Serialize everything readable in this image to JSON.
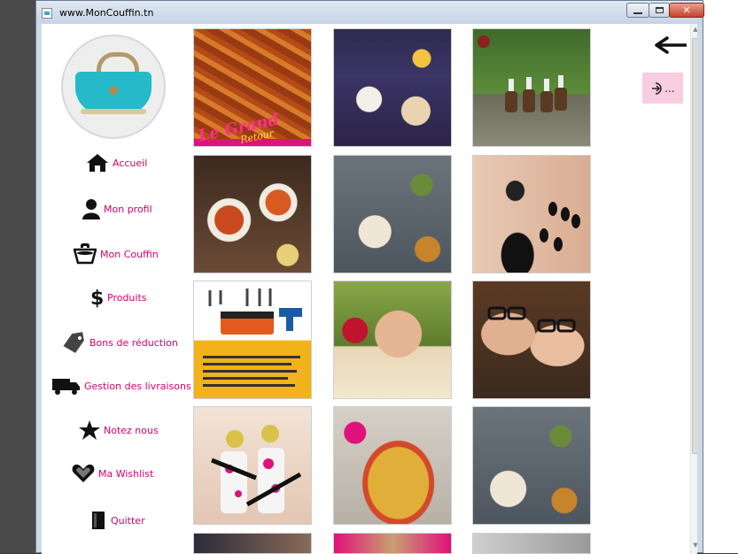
{
  "window": {
    "title": "www.MonCouffin.tn",
    "icons": {
      "app": "app-window-icon",
      "minimize": "minimize-icon",
      "maximize": "maximize-icon",
      "close": "close-icon"
    },
    "close_glyph": "✕"
  },
  "sidebar": {
    "avatar_icon": "bag-logo",
    "items": [
      {
        "label": "Accueil",
        "icon": "home-icon"
      },
      {
        "label": "Mon profil",
        "icon": "user-icon"
      },
      {
        "label": "Mon Couffin",
        "icon": "basket-icon"
      },
      {
        "label": "Produits",
        "icon": "dollar-icon"
      },
      {
        "label": "Bons de réduction",
        "icon": "tag-icon"
      },
      {
        "label": "Gestion des livraisons",
        "icon": "truck-icon"
      },
      {
        "label": "Notez nous",
        "icon": "star-icon"
      },
      {
        "label": "Ma Wishlist",
        "icon": "heart-icon"
      },
      {
        "label": "Quitter",
        "icon": "exit-icon"
      }
    ],
    "accent_color": "#d5006d"
  },
  "tiles": [
    {
      "subject": "pizza",
      "caption": "Le Grand",
      "caption_sub": "Retour"
    },
    {
      "subject": "breakfast-table"
    },
    {
      "subject": "horse-riding"
    },
    {
      "subject": "pasta-dishes"
    },
    {
      "subject": "restaurant-table"
    },
    {
      "subject": "makeup-face"
    },
    {
      "subject": "tools-kit"
    },
    {
      "subject": "spa-massage"
    },
    {
      "subject": "eyewear-couple"
    },
    {
      "subject": "paintball"
    },
    {
      "subject": "buffet-platter"
    },
    {
      "subject": "restaurant-table-2"
    },
    {
      "subject": "partial-1"
    },
    {
      "subject": "partial-2"
    },
    {
      "subject": "partial-3"
    }
  ],
  "header_actions": {
    "back_icon": "arrow-left-icon",
    "logout_label": "...",
    "logout_icon": "logout-icon",
    "logout_color": "#f9cde0"
  }
}
